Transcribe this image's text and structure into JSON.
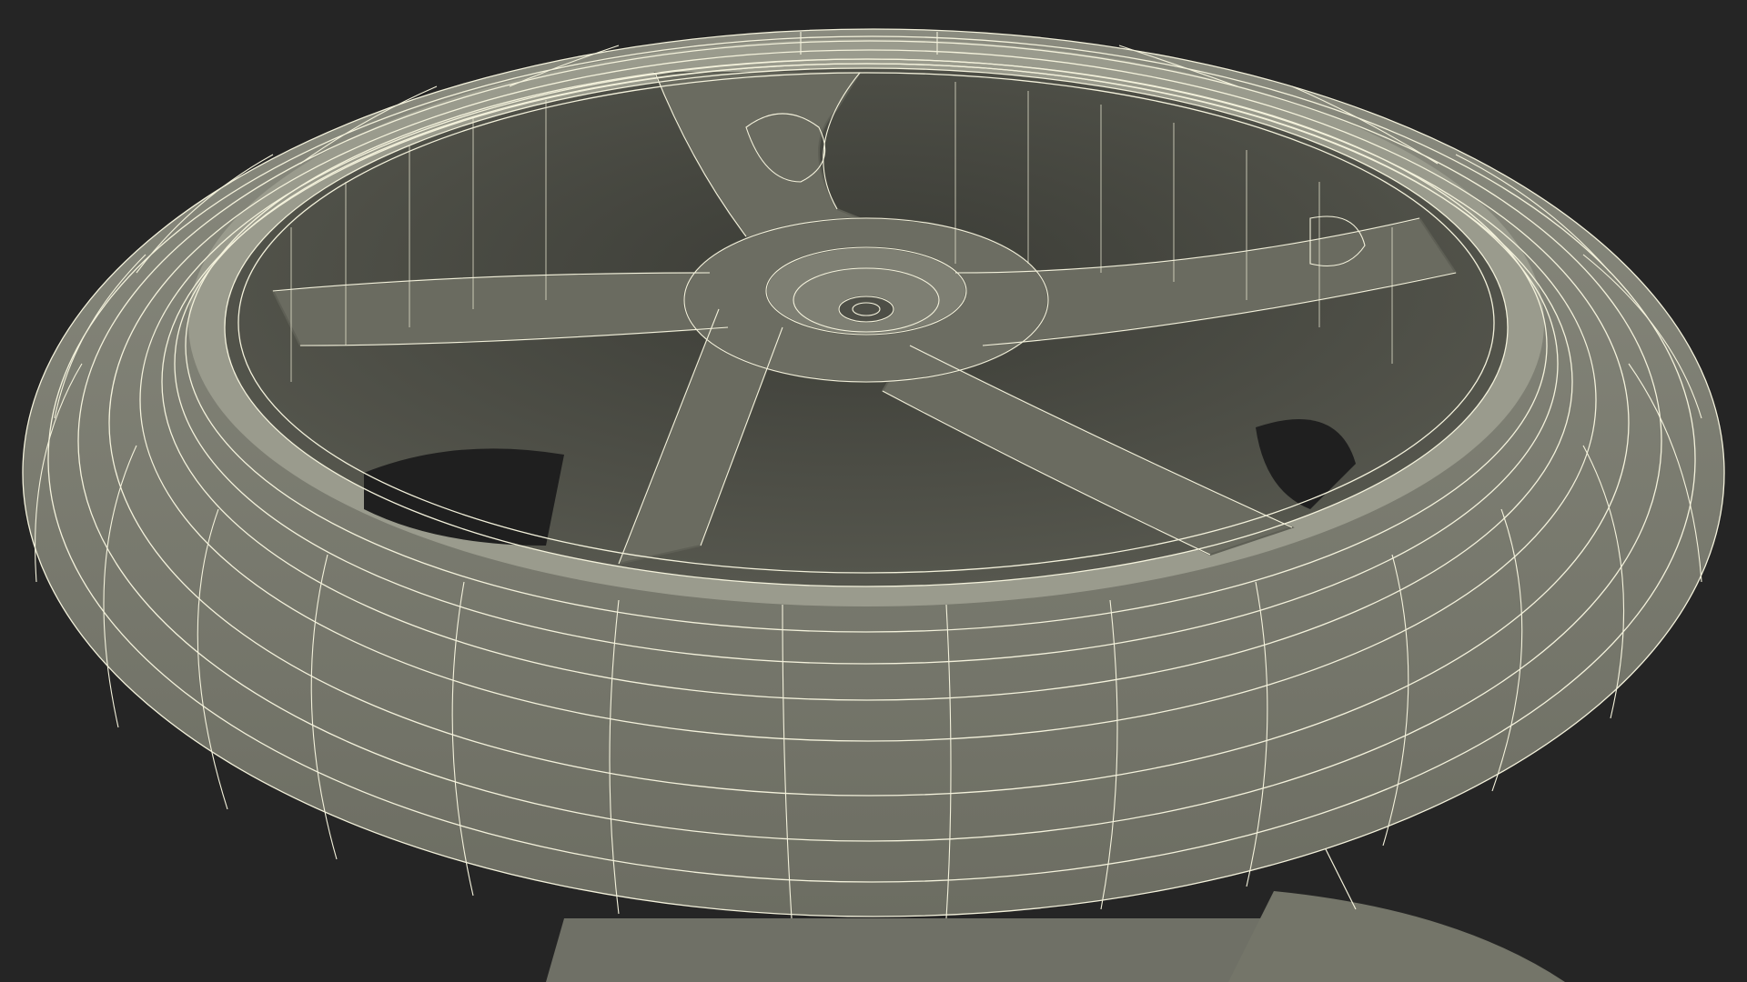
{
  "scene": {
    "subject": "wheel-wireframe-render",
    "background_color": "#252525",
    "surface_color": "#7b7c70",
    "surface_shadow_color": "#5a5b52",
    "wire_color": "#f4f2dc",
    "visible_spokes": 5
  }
}
